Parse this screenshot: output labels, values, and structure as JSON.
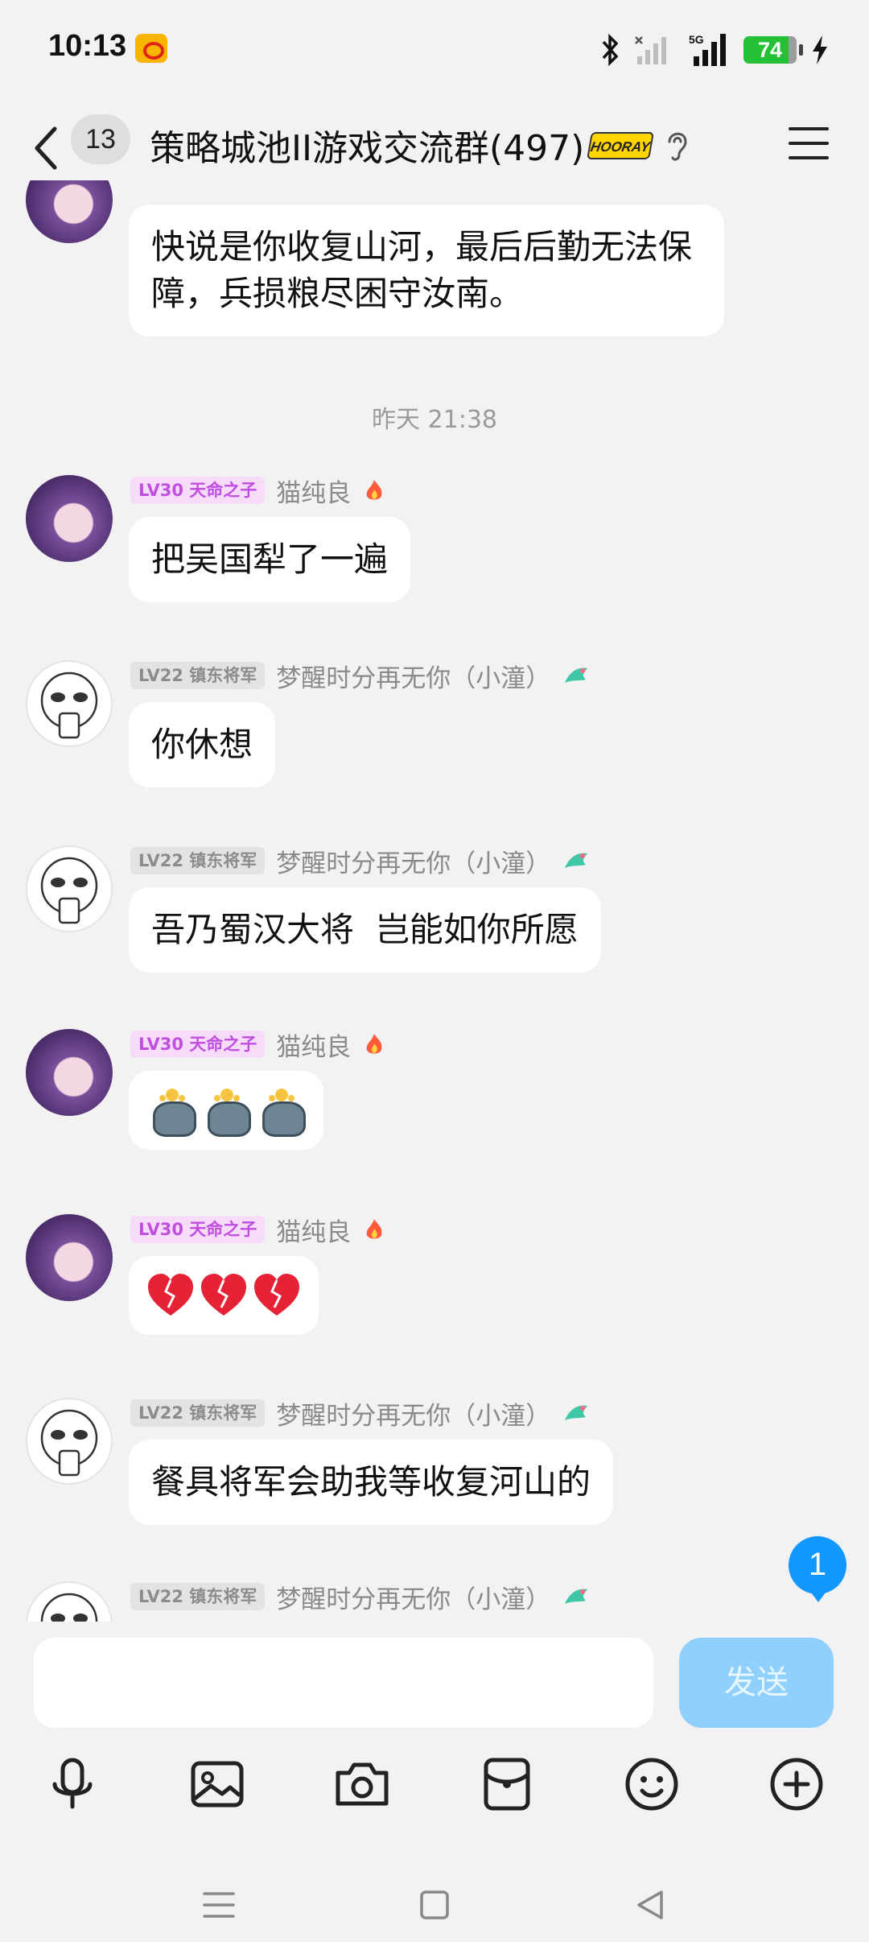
{
  "status_bar": {
    "time": "10:13",
    "network": "5G",
    "battery": "74",
    "icons": [
      "weibo-icon",
      "bluetooth-icon",
      "wifi-off-icon",
      "signal-icon",
      "battery-icon",
      "charging-icon"
    ]
  },
  "header": {
    "unread_count": "13",
    "title": "策略城池II游戏交流群(497)",
    "badge_text": "HOORAY"
  },
  "messages": [
    {
      "level": "LV30 天命之子",
      "nick": "猫纯良",
      "text": "快说是你收复山河，最后后勤无法保障，兵损粮尽困守汝南。"
    },
    {
      "divider": "昨天 21:38"
    },
    {
      "level": "LV30 天命之子",
      "nick": "猫纯良",
      "text": "把吴国犁了一遍"
    },
    {
      "level": "LV22 镇东将军",
      "nick": "梦醒时分再无你（小潼）",
      "text": "你休想"
    },
    {
      "level": "LV22 镇东将军",
      "nick": "梦醒时分再无你（小潼）",
      "text": "吾乃蜀汉大将  岂能如你所愿"
    },
    {
      "level": "LV30 天命之子",
      "nick": "猫纯良",
      "text": "",
      "emoji": "teapot-emoji x3"
    },
    {
      "level": "LV30 天命之子",
      "nick": "猫纯良",
      "text": "",
      "emoji": "broken-heart-emoji x3"
    },
    {
      "level": "LV22 镇东将军",
      "nick": "梦醒时分再无你（小潼）",
      "text": "餐具将军会助我等收复河山的"
    },
    {
      "level": "LV22 镇东将军",
      "nick": "梦醒时分再无你（小潼）",
      "text": ""
    }
  ],
  "new_message_badge": "1",
  "composer": {
    "input_value": "",
    "send_label": "发送"
  },
  "toolbar": [
    "microphone-icon",
    "image-icon",
    "camera-icon",
    "red-packet-icon",
    "emoji-icon",
    "plus-icon"
  ],
  "nav": [
    "menu-nav",
    "home-nav",
    "back-nav"
  ],
  "colors": {
    "background": "#f2f2f2",
    "bubble": "#ffffff",
    "send_button": "#8fd0ff",
    "badge_blue": "#1296ff",
    "level_pink_bg": "#f7dcfa",
    "level_pink_text": "#c04fe0",
    "battery_green": "#24c136"
  }
}
